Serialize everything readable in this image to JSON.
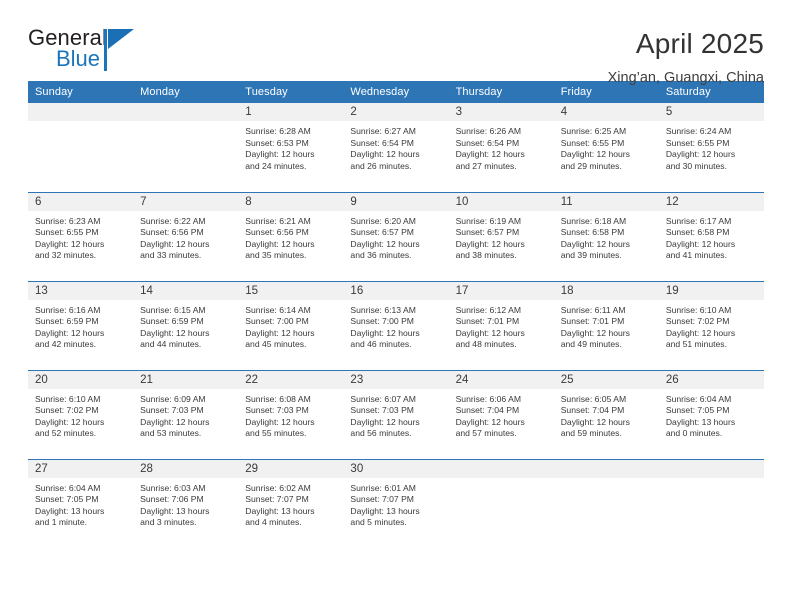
{
  "brand": {
    "name_part1": "General",
    "name_part2": "Blue",
    "mark": "triangle-flag-icon"
  },
  "header": {
    "title": "April 2025",
    "subtitle": "Xing’an, Guangxi, China"
  },
  "calendar": {
    "weekday_headers": [
      "Sunday",
      "Monday",
      "Tuesday",
      "Wednesday",
      "Thursday",
      "Friday",
      "Saturday"
    ],
    "accent_color": "#2e75b6",
    "daynum_bg": "#f1f1f1",
    "weeks": [
      [
        {
          "day": "",
          "lines": []
        },
        {
          "day": "",
          "lines": []
        },
        {
          "day": "1",
          "lines": [
            "Sunrise: 6:28 AM",
            "Sunset: 6:53 PM",
            "Daylight: 12 hours",
            "and 24 minutes."
          ]
        },
        {
          "day": "2",
          "lines": [
            "Sunrise: 6:27 AM",
            "Sunset: 6:54 PM",
            "Daylight: 12 hours",
            "and 26 minutes."
          ]
        },
        {
          "day": "3",
          "lines": [
            "Sunrise: 6:26 AM",
            "Sunset: 6:54 PM",
            "Daylight: 12 hours",
            "and 27 minutes."
          ]
        },
        {
          "day": "4",
          "lines": [
            "Sunrise: 6:25 AM",
            "Sunset: 6:55 PM",
            "Daylight: 12 hours",
            "and 29 minutes."
          ]
        },
        {
          "day": "5",
          "lines": [
            "Sunrise: 6:24 AM",
            "Sunset: 6:55 PM",
            "Daylight: 12 hours",
            "and 30 minutes."
          ]
        }
      ],
      [
        {
          "day": "6",
          "lines": [
            "Sunrise: 6:23 AM",
            "Sunset: 6:55 PM",
            "Daylight: 12 hours",
            "and 32 minutes."
          ]
        },
        {
          "day": "7",
          "lines": [
            "Sunrise: 6:22 AM",
            "Sunset: 6:56 PM",
            "Daylight: 12 hours",
            "and 33 minutes."
          ]
        },
        {
          "day": "8",
          "lines": [
            "Sunrise: 6:21 AM",
            "Sunset: 6:56 PM",
            "Daylight: 12 hours",
            "and 35 minutes."
          ]
        },
        {
          "day": "9",
          "lines": [
            "Sunrise: 6:20 AM",
            "Sunset: 6:57 PM",
            "Daylight: 12 hours",
            "and 36 minutes."
          ]
        },
        {
          "day": "10",
          "lines": [
            "Sunrise: 6:19 AM",
            "Sunset: 6:57 PM",
            "Daylight: 12 hours",
            "and 38 minutes."
          ]
        },
        {
          "day": "11",
          "lines": [
            "Sunrise: 6:18 AM",
            "Sunset: 6:58 PM",
            "Daylight: 12 hours",
            "and 39 minutes."
          ]
        },
        {
          "day": "12",
          "lines": [
            "Sunrise: 6:17 AM",
            "Sunset: 6:58 PM",
            "Daylight: 12 hours",
            "and 41 minutes."
          ]
        }
      ],
      [
        {
          "day": "13",
          "lines": [
            "Sunrise: 6:16 AM",
            "Sunset: 6:59 PM",
            "Daylight: 12 hours",
            "and 42 minutes."
          ]
        },
        {
          "day": "14",
          "lines": [
            "Sunrise: 6:15 AM",
            "Sunset: 6:59 PM",
            "Daylight: 12 hours",
            "and 44 minutes."
          ]
        },
        {
          "day": "15",
          "lines": [
            "Sunrise: 6:14 AM",
            "Sunset: 7:00 PM",
            "Daylight: 12 hours",
            "and 45 minutes."
          ]
        },
        {
          "day": "16",
          "lines": [
            "Sunrise: 6:13 AM",
            "Sunset: 7:00 PM",
            "Daylight: 12 hours",
            "and 46 minutes."
          ]
        },
        {
          "day": "17",
          "lines": [
            "Sunrise: 6:12 AM",
            "Sunset: 7:01 PM",
            "Daylight: 12 hours",
            "and 48 minutes."
          ]
        },
        {
          "day": "18",
          "lines": [
            "Sunrise: 6:11 AM",
            "Sunset: 7:01 PM",
            "Daylight: 12 hours",
            "and 49 minutes."
          ]
        },
        {
          "day": "19",
          "lines": [
            "Sunrise: 6:10 AM",
            "Sunset: 7:02 PM",
            "Daylight: 12 hours",
            "and 51 minutes."
          ]
        }
      ],
      [
        {
          "day": "20",
          "lines": [
            "Sunrise: 6:10 AM",
            "Sunset: 7:02 PM",
            "Daylight: 12 hours",
            "and 52 minutes."
          ]
        },
        {
          "day": "21",
          "lines": [
            "Sunrise: 6:09 AM",
            "Sunset: 7:03 PM",
            "Daylight: 12 hours",
            "and 53 minutes."
          ]
        },
        {
          "day": "22",
          "lines": [
            "Sunrise: 6:08 AM",
            "Sunset: 7:03 PM",
            "Daylight: 12 hours",
            "and 55 minutes."
          ]
        },
        {
          "day": "23",
          "lines": [
            "Sunrise: 6:07 AM",
            "Sunset: 7:03 PM",
            "Daylight: 12 hours",
            "and 56 minutes."
          ]
        },
        {
          "day": "24",
          "lines": [
            "Sunrise: 6:06 AM",
            "Sunset: 7:04 PM",
            "Daylight: 12 hours",
            "and 57 minutes."
          ]
        },
        {
          "day": "25",
          "lines": [
            "Sunrise: 6:05 AM",
            "Sunset: 7:04 PM",
            "Daylight: 12 hours",
            "and 59 minutes."
          ]
        },
        {
          "day": "26",
          "lines": [
            "Sunrise: 6:04 AM",
            "Sunset: 7:05 PM",
            "Daylight: 13 hours",
            "and 0 minutes."
          ]
        }
      ],
      [
        {
          "day": "27",
          "lines": [
            "Sunrise: 6:04 AM",
            "Sunset: 7:05 PM",
            "Daylight: 13 hours",
            "and 1 minute."
          ]
        },
        {
          "day": "28",
          "lines": [
            "Sunrise: 6:03 AM",
            "Sunset: 7:06 PM",
            "Daylight: 13 hours",
            "and 3 minutes."
          ]
        },
        {
          "day": "29",
          "lines": [
            "Sunrise: 6:02 AM",
            "Sunset: 7:07 PM",
            "Daylight: 13 hours",
            "and 4 minutes."
          ]
        },
        {
          "day": "30",
          "lines": [
            "Sunrise: 6:01 AM",
            "Sunset: 7:07 PM",
            "Daylight: 13 hours",
            "and 5 minutes."
          ]
        },
        {
          "day": "",
          "lines": []
        },
        {
          "day": "",
          "lines": []
        },
        {
          "day": "",
          "lines": []
        }
      ]
    ]
  }
}
